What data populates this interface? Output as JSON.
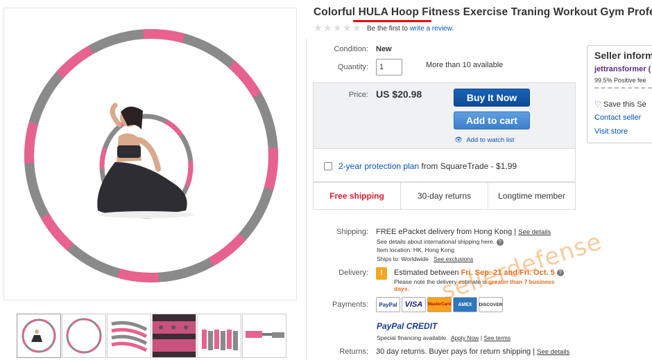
{
  "listing": {
    "title": "Colorful HULA Hoop Fitness Exercise Traning Workout Gym Profess",
    "review_prefix": "Be the first to",
    "review_link": "write a review.",
    "stars_filled": 0,
    "stars_total": 5
  },
  "details": {
    "condition_label": "Condition:",
    "condition_value": "New",
    "quantity_label": "Quantity:",
    "quantity_value": "1",
    "availability": "More than 10 available"
  },
  "buybox": {
    "price_label": "Price:",
    "price_value": "US $20.98",
    "buy_now": "Buy It Now",
    "add_to_cart": "Add to cart",
    "watch_list": "Add to watch list",
    "protection_link": "2-year protection plan",
    "protection_rest": "from SquareTrade - $1.99"
  },
  "badges": [
    "Free shipping",
    "30-day returns",
    "Longtime member"
  ],
  "shipping": {
    "label": "Shipping:",
    "main": "FREE  ePacket delivery from Hong Kong |",
    "see_details": "See details",
    "intl_note": "See details about international shipping here.",
    "item_location": "Item location:  HK, Hong Kong",
    "ships_to_label": "Ships to:  Worldwide",
    "see_exclusions": "See exclusions"
  },
  "delivery": {
    "label": "Delivery:",
    "estimated_prefix": "Estimated between",
    "estimated_dates": "Fri. Sep. 21 and Fri. Oct. 5",
    "note_prefix": "Please note the delivery estimate is",
    "note_highlight": "greater than 7 business",
    "note_highlight2": "days."
  },
  "payments": {
    "label": "Payments:",
    "methods": [
      "PayPal",
      "VISA",
      "MasterCard",
      "AMEX",
      "DISCOVER"
    ],
    "credit_logo": "PayPal CREDIT",
    "financing": "Special financing available.",
    "apply_now": "Apply Now",
    "see_terms": "See terms"
  },
  "returns": {
    "label": "Returns:",
    "text": "30 day returns. Buyer pays for return shipping |",
    "see_details": "See details"
  },
  "seller": {
    "title": "Seller inform",
    "name": "jettransformer (",
    "feedback": "99.5% Positive fee",
    "save": "Save this Se",
    "contact": "Contact seller",
    "visit": "Visit store"
  },
  "watermark": "sellerdefense",
  "colors": {
    "hoop_pink": "#e8628e",
    "hoop_gray": "#8a8a8a",
    "link_blue": "#0654ba",
    "free_red": "#dd1e31",
    "title_underline": "#e00000"
  }
}
